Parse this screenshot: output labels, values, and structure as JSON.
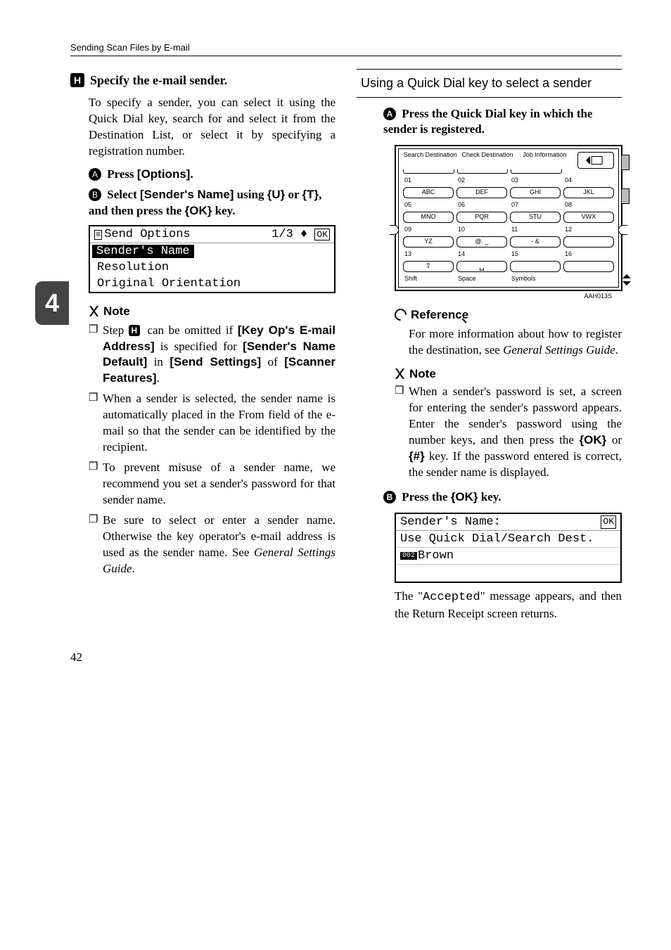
{
  "running_header": "Sending Scan Files by E-mail",
  "side_tab": "4",
  "left": {
    "step8_num": "H",
    "step8_text": "Specify the e-mail sender.",
    "step8_body": "To specify a sender, you can select it using the Quick Dial key, search for and select it from the Destination List, or select it by specifying a registration number.",
    "sub1_num": "A",
    "sub1_prefix": "Press ",
    "sub1_key": "[Options]",
    "sub1_suffix": ".",
    "sub2_num": "B",
    "sub2_a": "Select ",
    "sub2_key1": "[Sender's Name]",
    "sub2_b": " using ",
    "sub2_up": "{U}",
    "sub2_c": " or ",
    "sub2_down": "{T}",
    "sub2_d": ", and then press the ",
    "sub2_ok": "{OK}",
    "sub2_e": " key.",
    "screen": {
      "title_left": "Send Options",
      "title_right": "1/3",
      "ok": "OK",
      "row1": "Sender's Name",
      "row2": "Resolution",
      "row3": "Original Orientation"
    },
    "note_label": "Note",
    "note1_a": "Step ",
    "note1_step": "H",
    "note1_b": " can be omitted if ",
    "note1_k1": "[Key Op's E-mail Address]",
    "note1_c": " is specified for ",
    "note1_k2": "[Sender's Name Default]",
    "note1_d": " in ",
    "note1_k3": "[Send Settings]",
    "note1_e": " of ",
    "note1_k4": "[Scanner Features]",
    "note1_f": ".",
    "note2": "When a sender is selected, the sender name is automatically placed in the From field of the e-mail so that the sender can be identified by the recipient.",
    "note3": "To prevent misuse of a sender name, we recommend you set a sender's password for that sender name.",
    "note4_a": "Be sure to select or enter a sender name. Otherwise the key operator's e-mail address is used as the sender name. See ",
    "note4_i": "General Settings Guide",
    "note4_b": "."
  },
  "right": {
    "box_title": "Using a Quick Dial key to select a sender",
    "s1_num": "A",
    "s1_text": "Press the Quick Dial key in which the sender is registered.",
    "keypad": {
      "top": [
        "Search Destination",
        "Check Destination",
        "Job Information"
      ],
      "r1n": [
        "01",
        "02",
        "03",
        "04"
      ],
      "r1k": [
        "ABC",
        "DEF",
        "GHI",
        "JKL"
      ],
      "r2n": [
        "05",
        "06",
        "07",
        "08"
      ],
      "r2k": [
        "MNO",
        "PQR",
        "STU",
        "VWX"
      ],
      "r3n": [
        "09",
        "10",
        "11",
        "12"
      ],
      "r3k": [
        "YZ",
        "@. _",
        "- &",
        ""
      ],
      "r4n": [
        "13",
        "14",
        "15",
        "16"
      ],
      "bot_labels": [
        "Shift",
        "Space",
        "Symbols",
        ""
      ]
    },
    "img_code": "AAH013S",
    "ref_label": "Reference",
    "ref_body_a": "For more information about how to register the destination, see ",
    "ref_body_i": "General Settings Guide",
    "ref_body_b": ".",
    "note_label": "Note",
    "noteR_a": "When a sender's password is set, a screen for entering the sender's password appears. Enter the sender's password using the number keys, and then press the ",
    "noteR_ok": "{OK}",
    "noteR_b": " or ",
    "noteR_hash": "{#}",
    "noteR_c": " key. If the password entered is correct, the sender name is displayed.",
    "s2_num": "B",
    "s2_a": "Press the ",
    "s2_ok": "{OK}",
    "s2_b": " key.",
    "screen2": {
      "title": "Sender's Name:",
      "ok": "OK",
      "line2": "Use Quick Dial/Search Dest.",
      "badge": "002",
      "name": "Brown"
    },
    "tail_a": "The \"",
    "tail_mono": "Accepted",
    "tail_b": "\" message appears, and then the Return Receipt screen returns."
  },
  "page_num": "42"
}
